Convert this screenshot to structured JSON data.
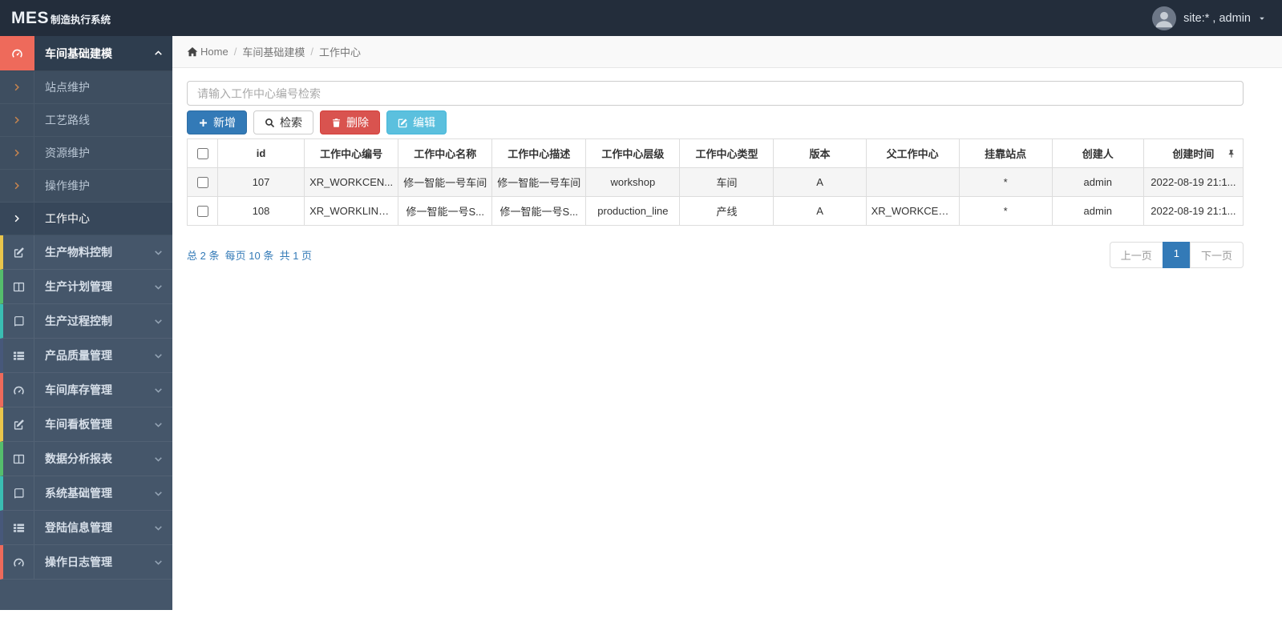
{
  "navbar": {
    "logo_primary": "MES",
    "logo_secondary": "制造执行系统",
    "user": {
      "avatar_icon": "user",
      "label": "site:* , admin",
      "caret_icon": "caret-down"
    }
  },
  "sidebar": {
    "items": [
      {
        "label": "车间基础建模",
        "icon": "dashboard",
        "color": "#ee6a5b",
        "chevron": "chevron-up",
        "expanded": true,
        "children": [
          {
            "label": "站点维护",
            "icon": "chevron-right"
          },
          {
            "label": "工艺路线",
            "icon": "chevron-right"
          },
          {
            "label": "资源维护",
            "icon": "chevron-right"
          },
          {
            "label": "操作维护",
            "icon": "chevron-right"
          },
          {
            "label": "工作中心",
            "icon": "chevron-right",
            "active": true
          }
        ]
      },
      {
        "label": "生产物料控制",
        "icon": "pencil-square",
        "color": "#e9c54b",
        "chevron": "chevron-down"
      },
      {
        "label": "生产计划管理",
        "icon": "columns",
        "color": "#55bd6c",
        "chevron": "chevron-down"
      },
      {
        "label": "生产过程控制",
        "icon": "book",
        "color": "#3abdb2",
        "chevron": "chevron-down"
      },
      {
        "label": "产品质量管理",
        "icon": "th-list",
        "color": "#47587a",
        "chevron": "chevron-down"
      },
      {
        "label": "车间库存管理",
        "icon": "dashboard",
        "color": "#ee6a5b",
        "chevron": "chevron-down"
      },
      {
        "label": "车间看板管理",
        "icon": "pencil-square",
        "color": "#e9c54b",
        "chevron": "chevron-down"
      },
      {
        "label": "数据分析报表",
        "icon": "columns",
        "color": "#55bd6c",
        "chevron": "chevron-down"
      },
      {
        "label": "系统基础管理",
        "icon": "book",
        "color": "#3abdb2",
        "chevron": "chevron-down"
      },
      {
        "label": "登陆信息管理",
        "icon": "th-list",
        "color": "#47587a",
        "chevron": "chevron-down"
      },
      {
        "label": "操作日志管理",
        "icon": "dashboard",
        "color": "#ee6a5b",
        "chevron": "chevron-down"
      }
    ]
  },
  "breadcrumb": {
    "home_icon": "home",
    "home_label": "Home",
    "separator": "/",
    "items": [
      "车间基础建模",
      "工作中心"
    ]
  },
  "toolbar": {
    "search_placeholder": "请输入工作中心编号检索",
    "buttons": [
      {
        "label": "新增",
        "icon": "plus",
        "variant": "primary"
      },
      {
        "label": "检索",
        "icon": "search",
        "variant": "default"
      },
      {
        "label": "删除",
        "icon": "trash",
        "variant": "danger"
      },
      {
        "label": "编辑",
        "icon": "edit",
        "variant": "info"
      }
    ]
  },
  "table": {
    "pin_icon": "pin",
    "columns": [
      "id",
      "工作中心编号",
      "工作中心名称",
      "工作中心描述",
      "工作中心层级",
      "工作中心类型",
      "版本",
      "父工作中心",
      "挂靠站点",
      "创建人",
      "创建时间"
    ],
    "rows": [
      {
        "cells": [
          "107",
          "XR_WORKCEN...",
          "修一智能一号车间",
          "修一智能一号车间",
          "workshop",
          "车间",
          "A",
          "",
          "*",
          "admin",
          "2022-08-19 21:1..."
        ]
      },
      {
        "cells": [
          "108",
          "XR_WORKLINE...",
          "修一智能一号S...",
          "修一智能一号S...",
          "production_line",
          "产线",
          "A",
          "XR_WORKCEN...",
          "*",
          "admin",
          "2022-08-19 21:1..."
        ]
      }
    ]
  },
  "pagination": {
    "summary": "总 2 条  每页 10 条  共 1 页",
    "prev": "上一页",
    "current": "1",
    "next": "下一页"
  },
  "colors": {
    "navbar_bg": "#232d3b",
    "sidebar_bg": "#45566a",
    "primary": "#337ab7",
    "danger": "#d9534f",
    "info": "#5bc0de",
    "sidebar_active_accent": "#ee6a5b"
  }
}
